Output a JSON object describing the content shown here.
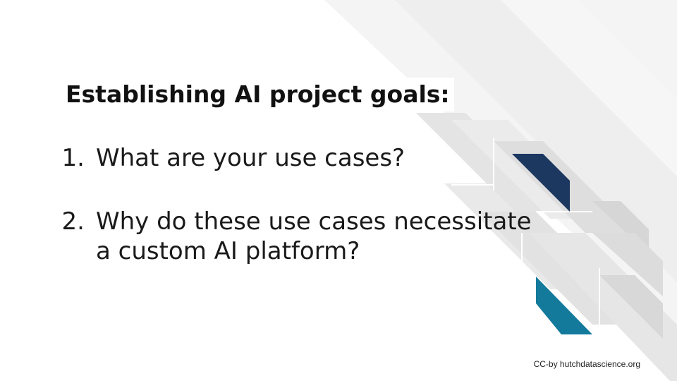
{
  "slide": {
    "title": "Establishing AI project goals:",
    "items": [
      {
        "number": "1.",
        "lines": [
          "What are your use cases?"
        ]
      },
      {
        "number": "2.",
        "lines": [
          "Why do these use cases necessitate",
          "a custom AI platform?"
        ]
      }
    ],
    "footer": "CC-by hutchdatascience.org"
  },
  "colors": {
    "background": "#ffffff",
    "stripe_light": "#f2f2f2",
    "stripe_mid": "#e6e6e6",
    "stripe_dark": "#d9d9d9",
    "accent_navy": "#1c3760",
    "accent_teal": "#137a9c"
  }
}
